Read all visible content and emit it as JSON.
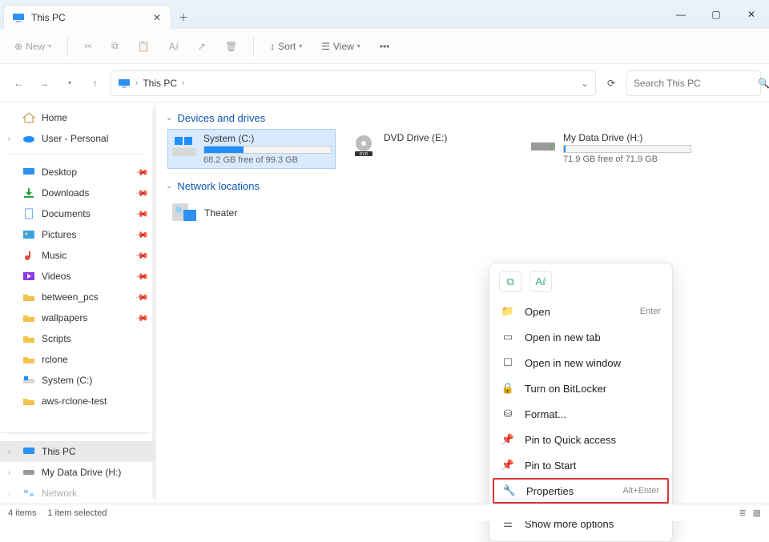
{
  "tab": {
    "title": "This PC"
  },
  "toolbar": {
    "new_label": "New",
    "sort_label": "Sort",
    "view_label": "View"
  },
  "breadcrumb": {
    "location": "This PC"
  },
  "search": {
    "placeholder": "Search This PC"
  },
  "sidebar": {
    "top": [
      {
        "label": "Home"
      },
      {
        "label": "User - Personal"
      }
    ],
    "quick": [
      {
        "label": "Desktop"
      },
      {
        "label": "Downloads"
      },
      {
        "label": "Documents"
      },
      {
        "label": "Pictures"
      },
      {
        "label": "Music"
      },
      {
        "label": "Videos"
      },
      {
        "label": "between_pcs"
      },
      {
        "label": "wallpapers"
      },
      {
        "label": "Scripts"
      },
      {
        "label": "rclone"
      },
      {
        "label": "System (C:)"
      },
      {
        "label": "aws-rclone-test"
      }
    ],
    "bottom": [
      {
        "label": "This PC"
      },
      {
        "label": "My Data Drive (H:)"
      },
      {
        "label": "Network"
      }
    ]
  },
  "sections": {
    "devices": "Devices and drives",
    "network": "Network locations"
  },
  "drives": [
    {
      "name": "System (C:)",
      "free_text": "68.2 GB free of 99.3 GB",
      "fill_pct": 31,
      "selected": true
    },
    {
      "name": "DVD Drive (E:)",
      "free_text": "",
      "fill_pct": 0,
      "selected": false
    },
    {
      "name": "My Data Drive (H:)",
      "free_text": "71.9 GB free of 71.9 GB",
      "fill_pct": 0,
      "selected": false
    }
  ],
  "network_locations": [
    {
      "name": "Theater"
    }
  ],
  "context_menu": {
    "items": [
      {
        "label": "Open",
        "shortcut": "Enter",
        "icon": "folder"
      },
      {
        "label": "Open in new tab",
        "shortcut": "",
        "icon": "tab"
      },
      {
        "label": "Open in new window",
        "shortcut": "",
        "icon": "window"
      },
      {
        "label": "Turn on BitLocker",
        "shortcut": "",
        "icon": "lock"
      },
      {
        "label": "Format...",
        "shortcut": "",
        "icon": "disk"
      },
      {
        "label": "Pin to Quick access",
        "shortcut": "",
        "icon": "pin"
      },
      {
        "label": "Pin to Start",
        "shortcut": "",
        "icon": "pin"
      },
      {
        "label": "Properties",
        "shortcut": "Alt+Enter",
        "icon": "wrench",
        "highlight": true
      },
      {
        "label": "Show more options",
        "shortcut": "",
        "icon": "more"
      }
    ]
  },
  "status": {
    "items": "4 items",
    "selected": "1 item selected"
  }
}
